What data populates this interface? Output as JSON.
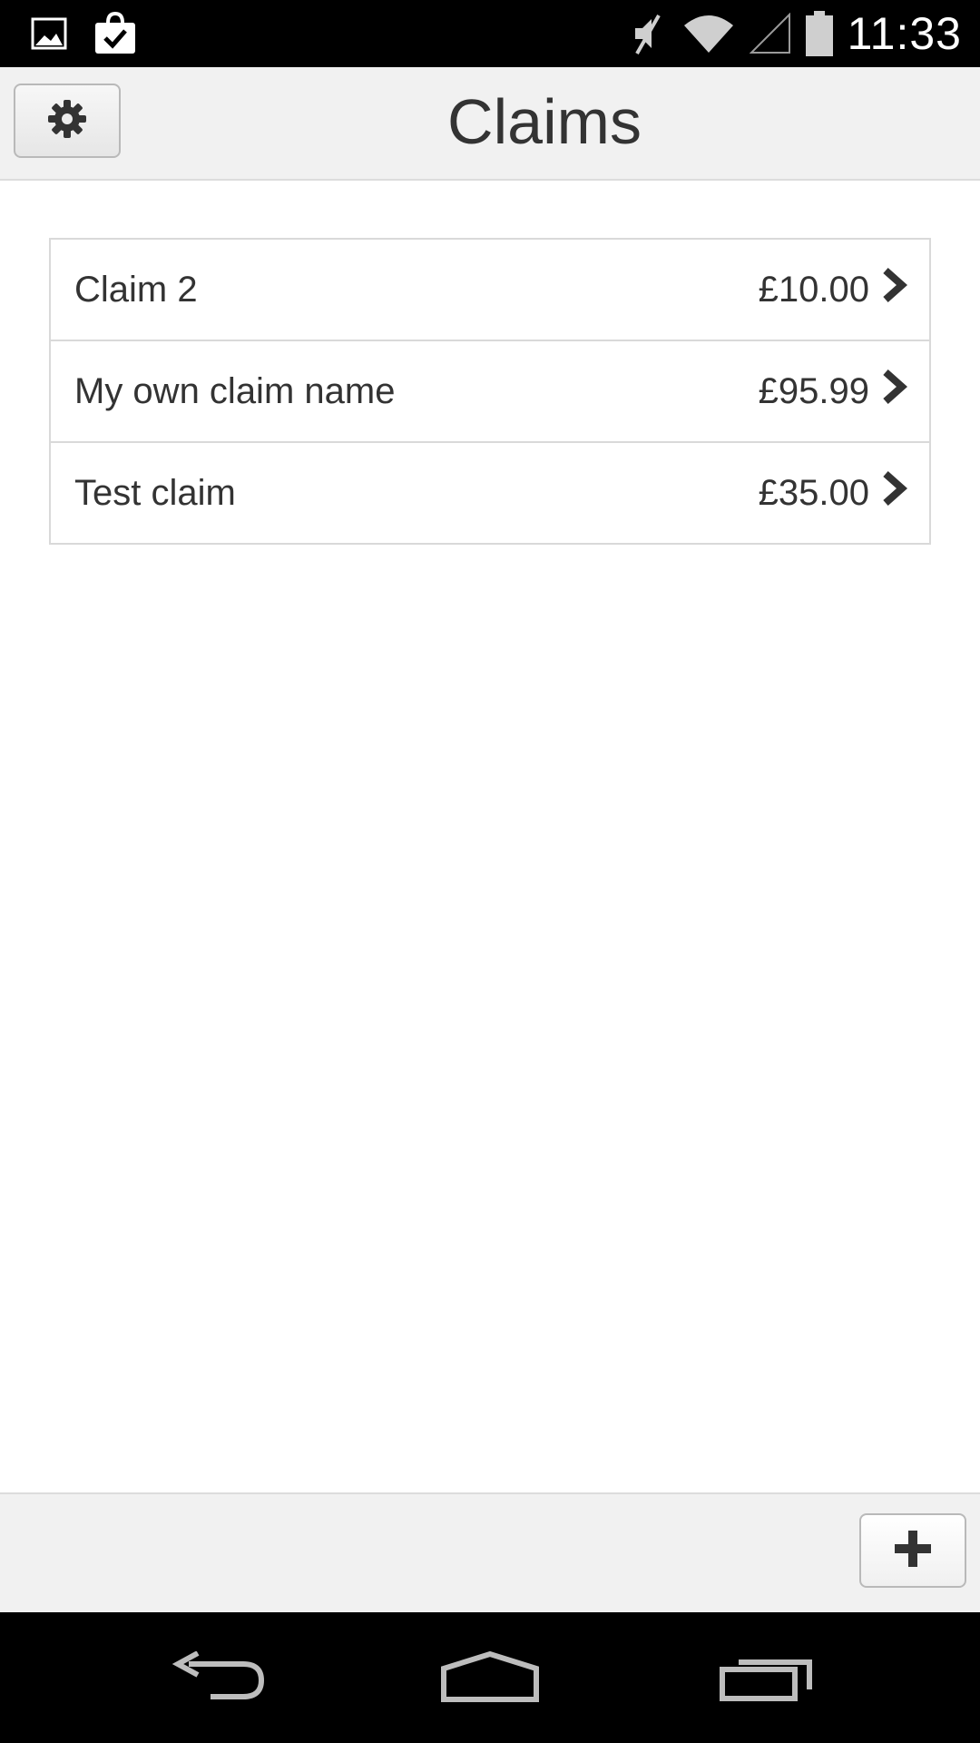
{
  "status_bar": {
    "time": "11:33",
    "left_icons": [
      "image-notification-icon",
      "store-notification-icon"
    ],
    "right_icons": [
      "mute-icon",
      "wifi-icon",
      "signal-icon",
      "battery-icon"
    ]
  },
  "header": {
    "title": "Claims",
    "settings_icon": "gear-icon"
  },
  "claims": [
    {
      "name": "Claim 2",
      "amount": "£10.00"
    },
    {
      "name": "My own claim name",
      "amount": "£95.99"
    },
    {
      "name": "Test claim",
      "amount": "£35.00"
    }
  ],
  "footer": {
    "add_icon": "plus-icon"
  },
  "nav_bar": {
    "buttons": [
      "back-icon",
      "home-icon",
      "recent-apps-icon"
    ]
  },
  "colors": {
    "header_bg": "#f1f1f1",
    "text": "#333333",
    "border": "#d9d9d9",
    "system_bar": "#000000"
  }
}
